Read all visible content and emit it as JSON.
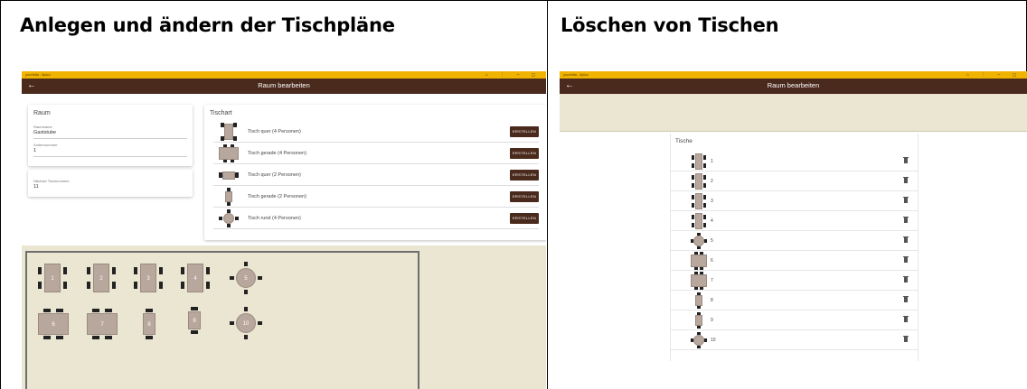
{
  "left": {
    "heading": "Anlegen und ändern der Tischpläne",
    "window_title": "yourlxfia - fipico",
    "appbar_title": "Raum bearbeiten",
    "room_card": {
      "heading": "Raum",
      "name_label": "Raumname",
      "name_value": "Gaststube",
      "sort_label": "Sortiernummer",
      "sort_value": "1",
      "next_label": "Nächste Tischnummer",
      "next_value": "11"
    },
    "types_card": {
      "heading": "Tischart",
      "button_label": "ERSTELLEN",
      "types": [
        {
          "label": "Tisch quer (4 Personen)",
          "icon": "table-quer-4-icon"
        },
        {
          "label": "Tisch gerade (4 Personen)",
          "icon": "table-gerade-4-icon"
        },
        {
          "label": "Tisch quer (2 Personen)",
          "icon": "table-quer-2-icon"
        },
        {
          "label": "Tisch gerade (2 Personen)",
          "icon": "table-gerade-2-icon"
        },
        {
          "label": "Tisch rund (4 Personen)",
          "icon": "table-rund-4-icon"
        }
      ]
    },
    "floor_tables": [
      "1",
      "2",
      "3",
      "4",
      "5",
      "6",
      "7",
      "8",
      "9",
      "10"
    ]
  },
  "right": {
    "heading": "Löschen von Tischen",
    "window_title": "yourlxfia - fipico",
    "appbar_title": "Raum bearbeiten",
    "list_heading": "Tische",
    "tables": [
      "1",
      "2",
      "3",
      "4",
      "5",
      "6",
      "7",
      "8",
      "9",
      "10"
    ]
  },
  "colors": {
    "titlebar": "#f0b400",
    "appbar": "#4a2a1c",
    "button": "#4a2a1c",
    "canvas": "#ebe6d2",
    "table": "#b8a79c"
  }
}
